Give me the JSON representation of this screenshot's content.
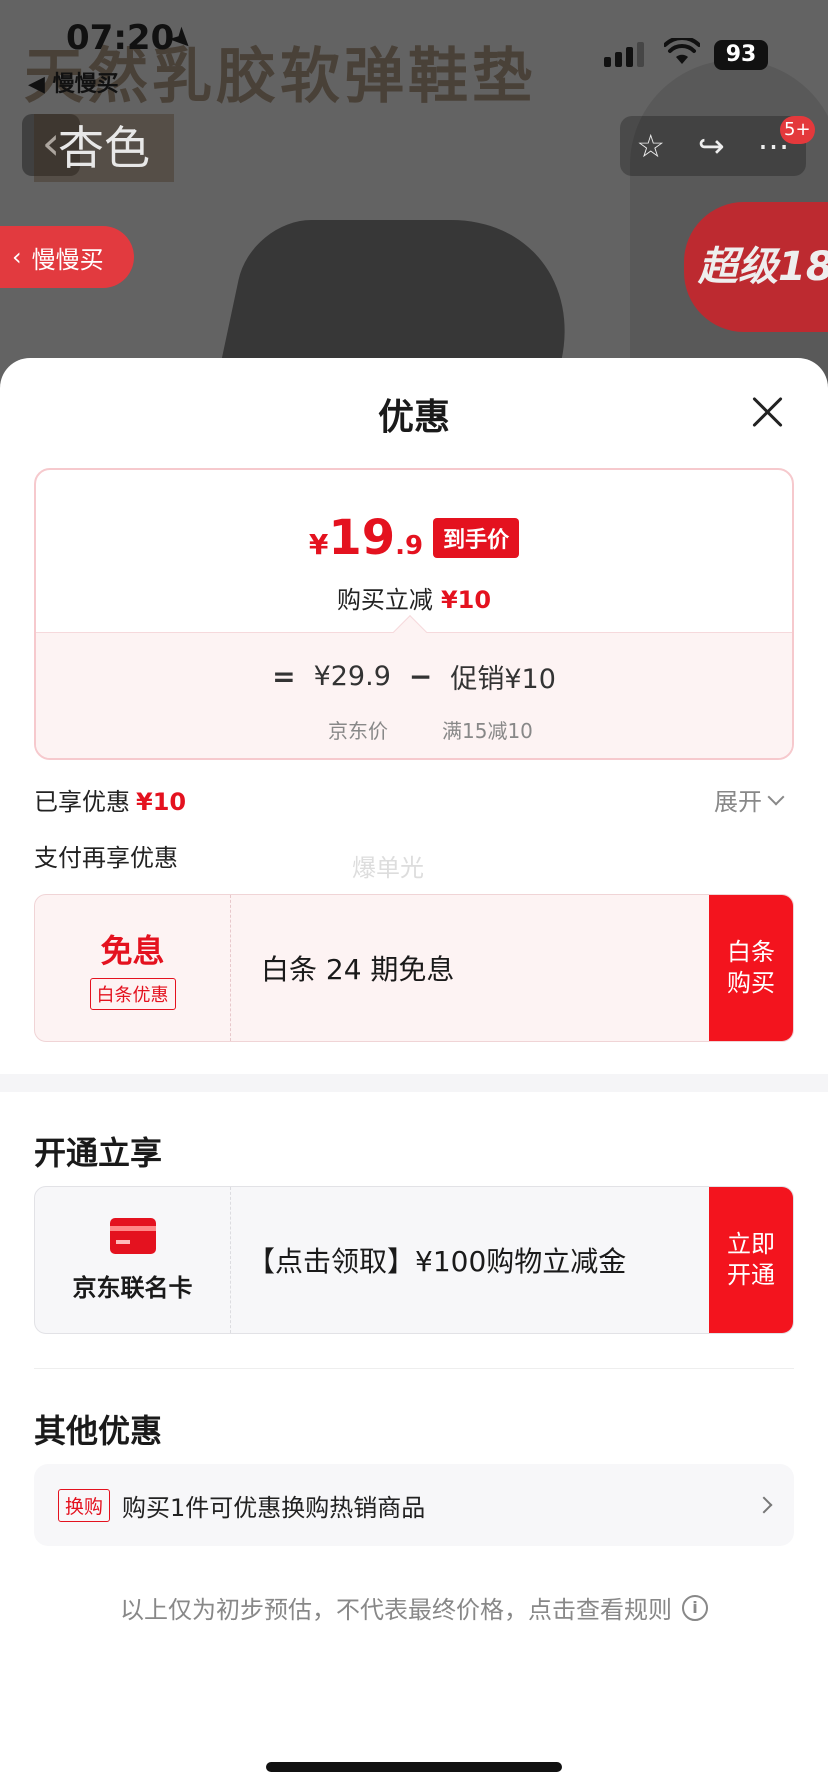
{
  "status_bar": {
    "time": "07:20",
    "back_app": "◀ 慢慢买",
    "battery": "93"
  },
  "background": {
    "banner_title": "天然乳胶软弹鞋垫",
    "color_label": "杏色",
    "back_icon": "‹",
    "badge": "5+",
    "slow_buy_label": "慢慢买",
    "promo_label": "超级18"
  },
  "sheet": {
    "title": "优惠",
    "price": {
      "currency": "¥",
      "integer": "19",
      "decimal": ".9",
      "tag": "到手价",
      "sub_label": "购买立减",
      "sub_amount": "¥10",
      "eq": "=",
      "jd_price": "¥29.9",
      "minus": "−",
      "promo": "促销¥10",
      "jd_price_label": "京东价",
      "promo_label": "满15减10"
    },
    "enjoyed": {
      "label": "已享优惠",
      "amount": "¥10",
      "expand": "展开"
    },
    "pay_more_label": "支付再享优惠",
    "watermark": "爆单光",
    "baitiao": {
      "highlight": "免息",
      "tag": "白条优惠",
      "text": "白条 24 期免息",
      "button": "白条购买"
    },
    "open_section_title": "开通立享",
    "jd_card": {
      "name": "京东联名卡",
      "text": "【点击领取】¥100购物立减金",
      "button": "立即开通"
    },
    "other_section_title": "其他优惠",
    "other_row": {
      "tag": "换购",
      "text": "购买1件可优惠换购热销商品"
    },
    "disclaimer": "以上仅为初步预估，不代表最终价格，点击查看规则",
    "info_icon": "i"
  }
}
